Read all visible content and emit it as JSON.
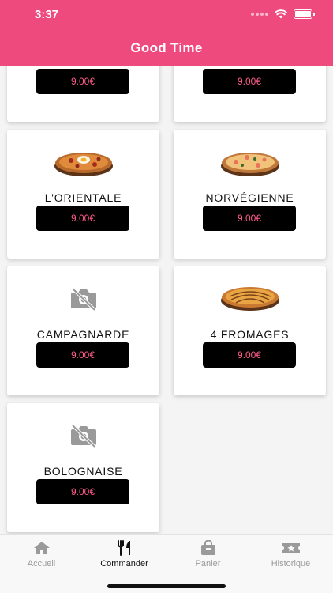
{
  "status": {
    "time": "3:37"
  },
  "header": {
    "title": "Good Time"
  },
  "products": [
    {
      "name": "",
      "price": "9.00€",
      "image": "cropped"
    },
    {
      "name": "",
      "price": "9.00€",
      "image": "cropped"
    },
    {
      "name": "L'ORIENTALE",
      "price": "9.00€",
      "image": "pizza-egg"
    },
    {
      "name": "NORVÉGIENNE",
      "price": "9.00€",
      "image": "pizza-salmon"
    },
    {
      "name": "CAMPAGNARDE",
      "price": "9.00€",
      "image": "no-photo"
    },
    {
      "name": "4 FROMAGES",
      "price": "9.00€",
      "image": "pizza-cheese"
    },
    {
      "name": "BOLOGNAISE",
      "price": "9.00€",
      "image": "no-photo"
    }
  ],
  "tabbar": {
    "tabs": [
      {
        "label": "Accueil",
        "icon": "home-icon",
        "active": false
      },
      {
        "label": "Commander",
        "icon": "utensils-icon",
        "active": true
      },
      {
        "label": "Panier",
        "icon": "bag-icon",
        "active": false
      },
      {
        "label": "Historique",
        "icon": "ticket-icon",
        "active": false
      }
    ]
  },
  "colors": {
    "header": "#ef4a7e",
    "price_text": "#ff5c8a",
    "button_bg": "#000000"
  }
}
